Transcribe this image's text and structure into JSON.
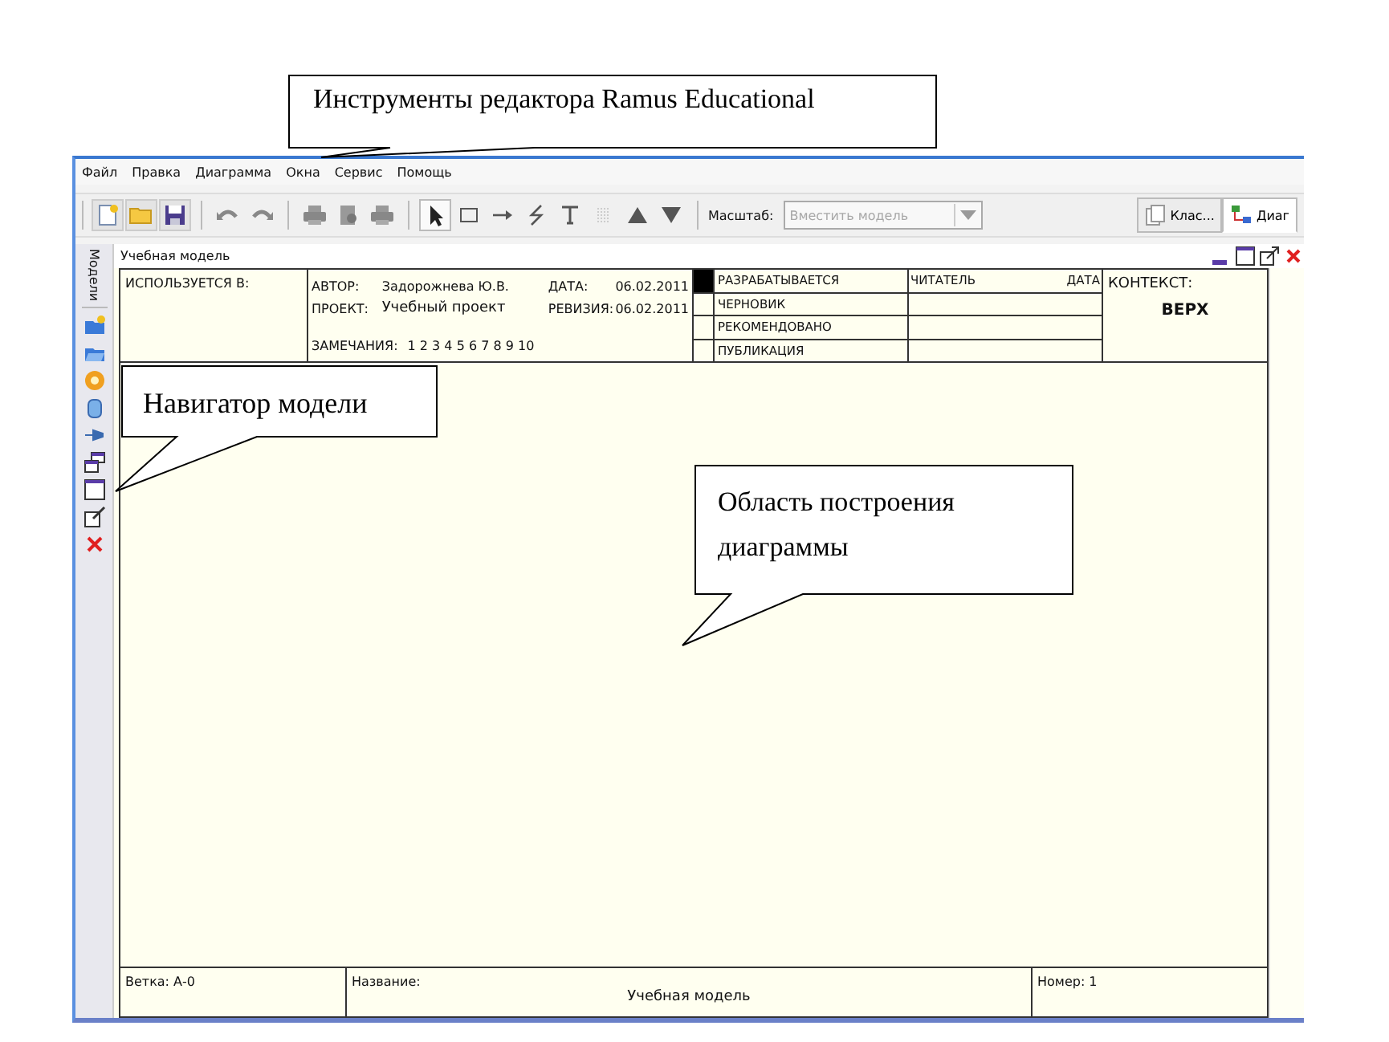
{
  "menu": [
    "Файл",
    "Правка",
    "Диаграмма",
    "Окна",
    "Сервис",
    "Помощь"
  ],
  "toolbar": {
    "groups": [
      [
        {
          "kind": "new",
          "selected": false
        },
        {
          "kind": "open",
          "selected": false
        },
        {
          "kind": "save",
          "selected": false
        }
      ],
      [
        {
          "kind": "undo",
          "selected": false
        },
        {
          "kind": "redo",
          "selected": false
        }
      ],
      [
        {
          "kind": "print",
          "selected": false
        },
        {
          "kind": "preview",
          "selected": false
        },
        {
          "kind": "print",
          "selected": false
        }
      ],
      [
        {
          "kind": "pointer",
          "selected": true
        },
        {
          "kind": "box",
          "selected": false
        },
        {
          "kind": "arrow",
          "selected": false
        },
        {
          "kind": "squiggle",
          "selected": false
        },
        {
          "kind": "text",
          "selected": false
        },
        {
          "kind": "dots",
          "selected": false
        },
        {
          "kind": "up",
          "selected": false
        },
        {
          "kind": "down",
          "selected": false
        }
      ]
    ],
    "zoom_label": "Масштаб:",
    "zoom_value": "Вместить модель",
    "zoom_disabled": true,
    "view_tabs": [
      {
        "label": "Клас...",
        "kind": "class",
        "selected": false
      },
      {
        "label": "Диаг",
        "kind": "diagram",
        "selected": true
      }
    ]
  },
  "navigator": {
    "tab": "Модели",
    "tools": [
      {
        "kind": "new"
      },
      {
        "kind": "open"
      },
      {
        "kind": "gear"
      },
      {
        "kind": "database"
      },
      {
        "kind": "pin"
      },
      {
        "kind": "windows"
      },
      {
        "kind": "window"
      },
      {
        "kind": "edit"
      },
      {
        "kind": "close"
      }
    ]
  },
  "document": {
    "title": "Учебная модель",
    "controls": [
      {
        "kind": "minimize"
      },
      {
        "kind": "maximize"
      },
      {
        "kind": "restore"
      },
      {
        "kind": "close"
      }
    ]
  },
  "header": {
    "used_in": "ИСПОЛЬЗУЕТСЯ В:",
    "author_label": "АВТОР:",
    "author": "Задорожнева Ю.В.",
    "date_label": "ДАТА:",
    "date": "06.02.2011",
    "project_label": "ПРОЕКТ:",
    "project": "Учебный проект",
    "revision_label": "РЕВИЗИЯ:",
    "revision": "06.02.2011",
    "notes_label": "ЗАМЕЧАНИЯ:",
    "notes": "1 2 3 4 5 6 7 8 9 10",
    "statuses": [
      {
        "label": "РАЗРАБАТЫВАЕТСЯ",
        "selected": true
      },
      {
        "label": "ЧЕРНОВИК",
        "selected": false
      },
      {
        "label": "РЕКОМЕНДОВАНО",
        "selected": false
      },
      {
        "label": "ПУБЛИКАЦИЯ",
        "selected": false
      }
    ],
    "reader_label": "ЧИТАТЕЛЬ",
    "reader_date_label": "ДАТА",
    "context_label": "КОНТЕКСТ:",
    "context": "ВЕРХ"
  },
  "footer": {
    "node_label": "Ветка:",
    "node": "А-0",
    "title_label": "Название:",
    "title": "Учебная модель",
    "number_label": "Номер:",
    "number": "1"
  },
  "callouts": [
    {
      "kind": "toolbar",
      "text": "Инструменты редактора Ramus Educational"
    },
    {
      "kind": "navigator",
      "text": "Навигатор модели"
    },
    {
      "kind": "canvas",
      "text": "Область построения диаграммы"
    }
  ]
}
